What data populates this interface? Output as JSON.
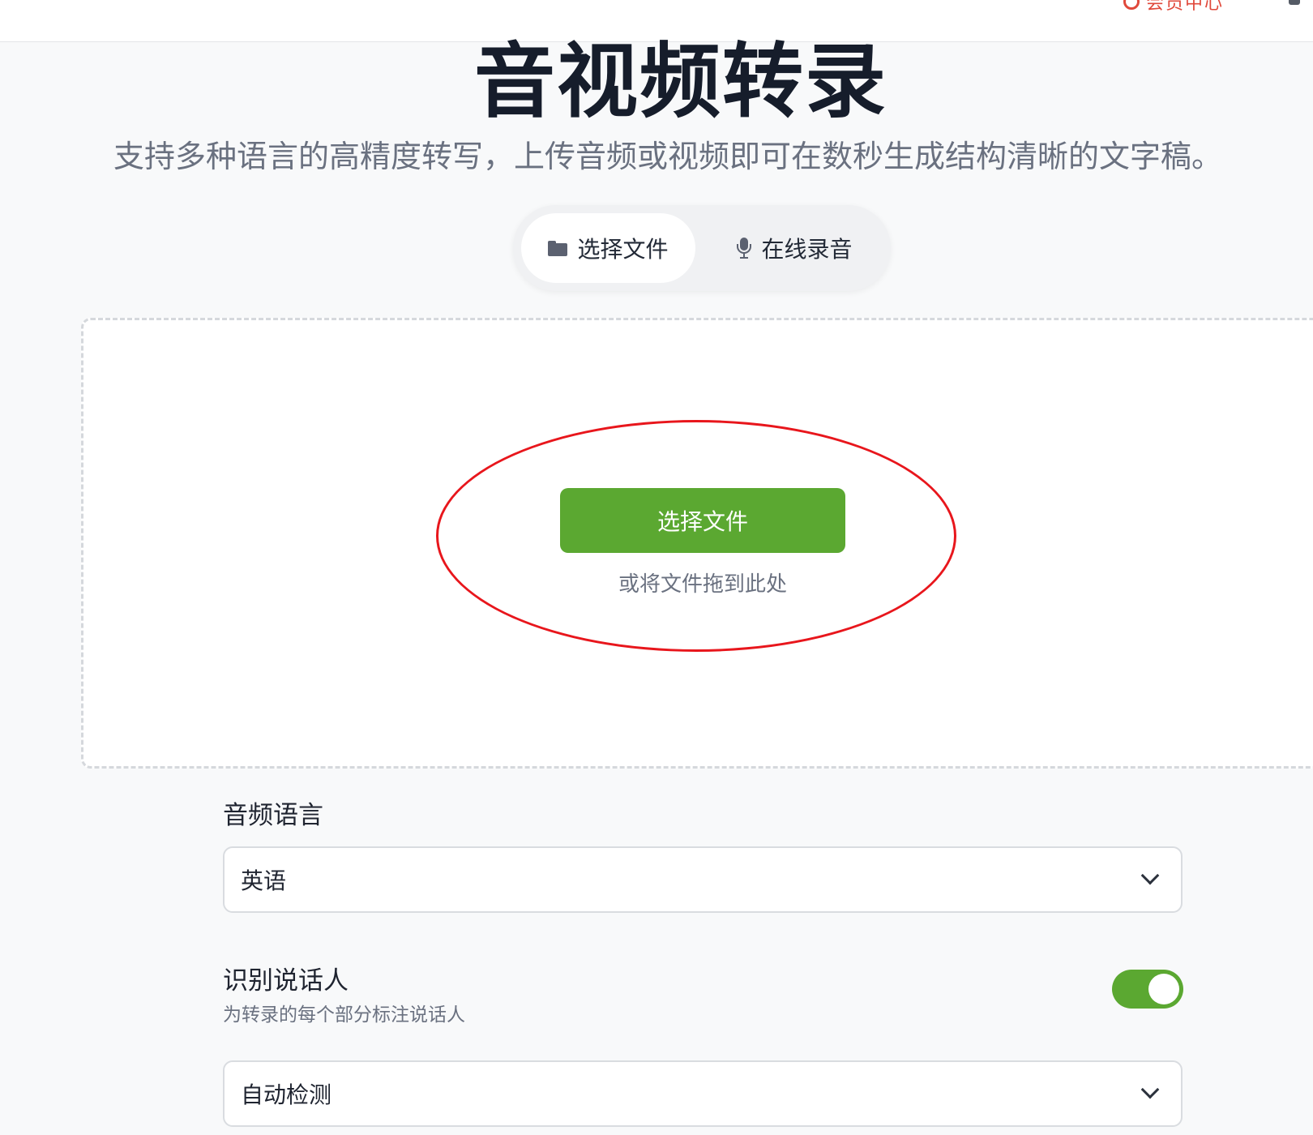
{
  "header": {
    "right_text": "会员中心"
  },
  "hero": {
    "title": "音视频转录",
    "subtitle": "支持多种语言的高精度转写，上传音频或视频即可在数秒生成结构清晰的文字稿。"
  },
  "mode_tabs": [
    {
      "label": "选择文件",
      "icon": "folder-icon",
      "active": true
    },
    {
      "label": "在线录音",
      "icon": "microphone-icon",
      "active": false
    }
  ],
  "upload": {
    "button_label": "选择文件",
    "hint": "或将文件拖到此处",
    "annotation_color": "#e8161c"
  },
  "settings": {
    "language": {
      "label": "音频语言",
      "value": "英语"
    },
    "speaker": {
      "label": "识别说话人",
      "description": "为转录的每个部分标注说话人",
      "enabled": true,
      "count_value": "自动检测"
    }
  },
  "colors": {
    "accent": "#5ba831",
    "title": "#161d2b",
    "muted": "#6a7180"
  }
}
